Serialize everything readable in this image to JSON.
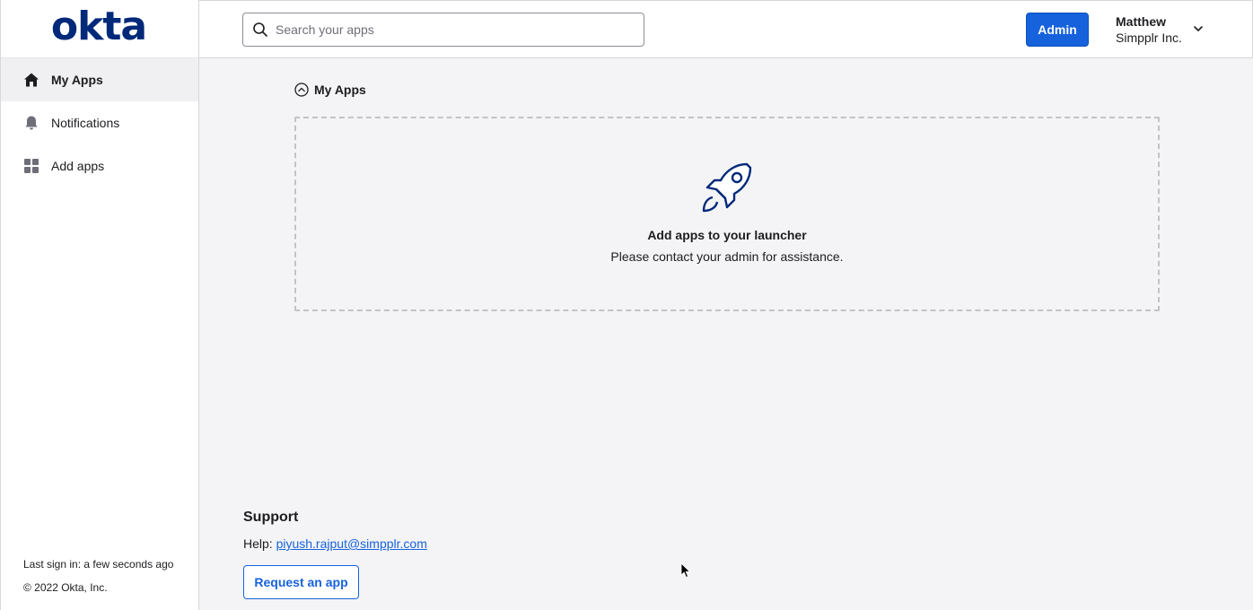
{
  "brand": {
    "logo_text": "okta",
    "color": "#00297a"
  },
  "sidebar": {
    "items": [
      {
        "label": "My Apps",
        "icon": "home-icon",
        "active": true
      },
      {
        "label": "Notifications",
        "icon": "bell-icon",
        "active": false
      },
      {
        "label": "Add apps",
        "icon": "grid-icon",
        "active": false
      }
    ],
    "last_sign_in": "Last sign in: a few seconds ago",
    "copyright": "© 2022 Okta, Inc."
  },
  "header": {
    "search_placeholder": "Search your apps",
    "search_value": "",
    "admin_label": "Admin",
    "admin_color": "#1662dd",
    "user_name": "Matthew",
    "user_org": "Simpplr Inc."
  },
  "main": {
    "section_title": "My Apps",
    "empty_title": "Add apps to your launcher",
    "empty_subtitle": "Please contact your admin for assistance."
  },
  "support": {
    "title": "Support",
    "help_prefix": "Help:",
    "help_email": "piyush.rajput@simpplr.com",
    "request_label": "Request an app"
  }
}
